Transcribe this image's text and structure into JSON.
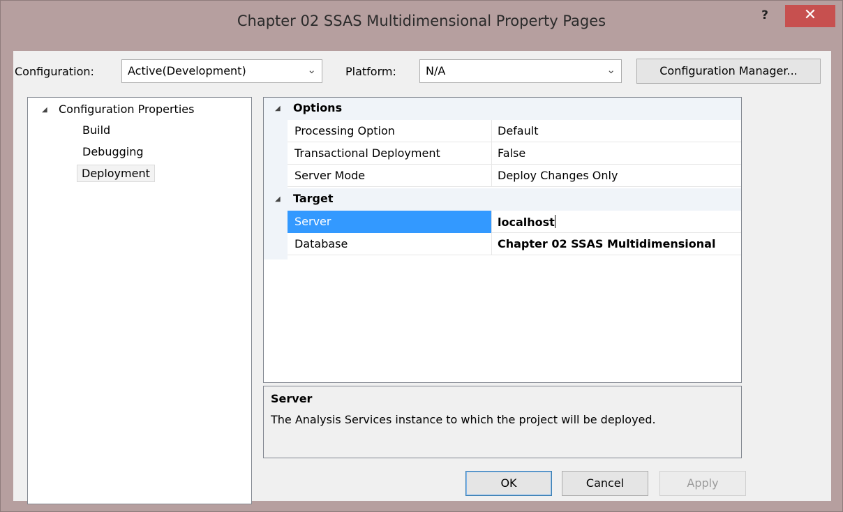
{
  "window": {
    "title": "Chapter 02 SSAS Multidimensional Property Pages",
    "help_label": "?",
    "close_label": "✕"
  },
  "toolbar": {
    "configuration_label": "Configuration:",
    "configuration_value": "Active(Development)",
    "platform_label": "Platform:",
    "platform_value": "N/A",
    "config_manager_label": "Configuration Manager..."
  },
  "tree": {
    "root_label": "Configuration Properties",
    "items": [
      {
        "label": "Build"
      },
      {
        "label": "Debugging"
      },
      {
        "label": "Deployment",
        "selected": true
      }
    ]
  },
  "property_grid": {
    "categories": [
      {
        "label": "Options",
        "properties": [
          {
            "name": "Processing Option",
            "value": "Default"
          },
          {
            "name": "Transactional Deployment",
            "value": "False"
          },
          {
            "name": "Server Mode",
            "value": "Deploy Changes Only"
          }
        ]
      },
      {
        "label": "Target",
        "properties": [
          {
            "name": "Server",
            "value": "localhost",
            "selected": true,
            "bold": true
          },
          {
            "name": "Database",
            "value": "Chapter 02 SSAS Multidimensional",
            "bold": true
          }
        ]
      }
    ]
  },
  "description": {
    "title": "Server",
    "text": "The Analysis Services instance to which the project will be deployed."
  },
  "buttons": {
    "ok_label": "OK",
    "cancel_label": "Cancel",
    "apply_label": "Apply"
  },
  "colors": {
    "selection": "#3399ff",
    "close_button": "#c7504f",
    "window_frame": "#b69f9f"
  }
}
